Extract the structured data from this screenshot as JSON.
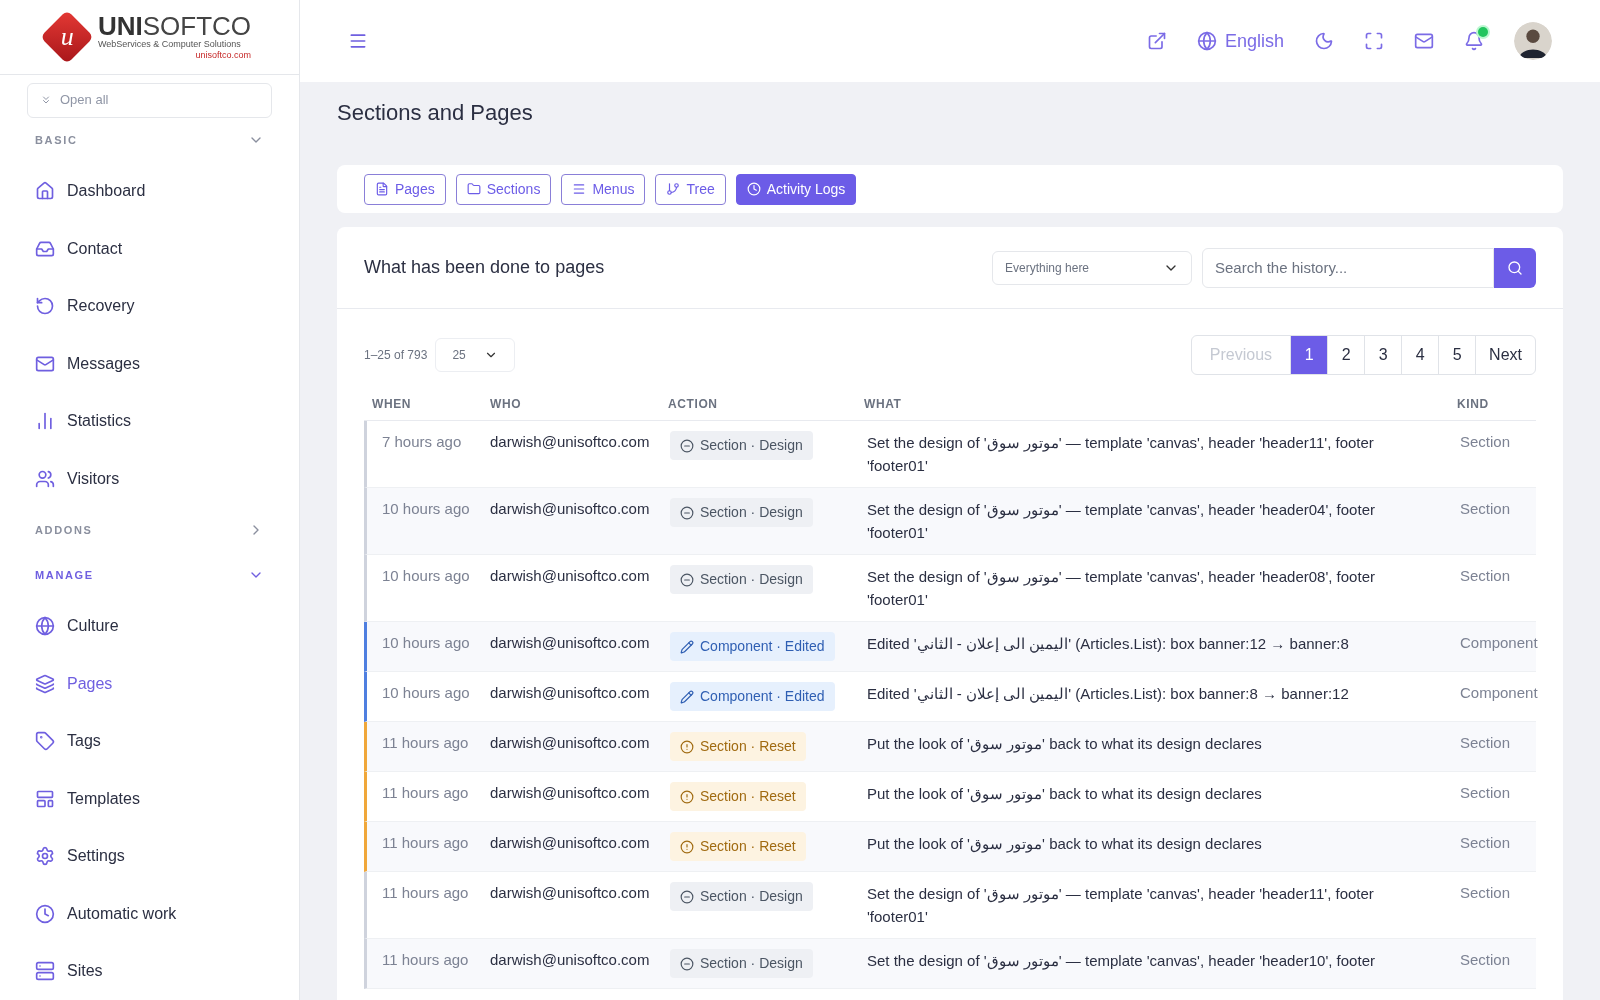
{
  "logo": {
    "mark": "u",
    "name_bold": "UNI",
    "name_light": "SOFTCO",
    "tagline": "WebServices & Computer Solutions",
    "url": "unisoftco.com"
  },
  "sidebar": {
    "open_all": "Open all",
    "groups": [
      {
        "title": "BASIC",
        "expanded": true,
        "items": [
          {
            "label": "Dashboard",
            "selected": false
          },
          {
            "label": "Contact",
            "selected": false
          },
          {
            "label": "Recovery",
            "selected": false
          },
          {
            "label": "Messages",
            "selected": false
          },
          {
            "label": "Statistics",
            "selected": false
          },
          {
            "label": "Visitors",
            "selected": false
          }
        ]
      },
      {
        "title": "ADDONS",
        "expanded": false
      },
      {
        "title": "MANAGE",
        "expanded": true,
        "items": [
          {
            "label": "Culture",
            "selected": false
          },
          {
            "label": "Pages",
            "selected": true
          },
          {
            "label": "Tags",
            "selected": false
          },
          {
            "label": "Templates",
            "selected": false
          },
          {
            "label": "Settings",
            "selected": false
          },
          {
            "label": "Automatic work",
            "selected": false
          },
          {
            "label": "Sites",
            "selected": false
          }
        ]
      }
    ]
  },
  "topbar": {
    "language": "English",
    "notification_dot": true
  },
  "page_title": "Sections and Pages",
  "tabs": [
    {
      "label": "Pages",
      "selected": false
    },
    {
      "label": "Sections",
      "selected": false
    },
    {
      "label": "Menus",
      "selected": false
    },
    {
      "label": "Tree",
      "selected": false
    },
    {
      "label": "Activity Logs",
      "selected": true
    }
  ],
  "log": {
    "title": "What has been done to pages",
    "filter": "Everything here",
    "search": {
      "placeholder": "Search the history..."
    },
    "range": "1–25 of 793",
    "page_size": "25",
    "pagination": {
      "previous": {
        "label": "Previous",
        "disabled": true
      },
      "pages": [
        {
          "label": "1",
          "selected": true
        },
        {
          "label": "2",
          "selected": false
        },
        {
          "label": "3",
          "selected": false
        },
        {
          "label": "4",
          "selected": false
        },
        {
          "label": "5",
          "selected": false
        }
      ],
      "next": {
        "label": "Next",
        "disabled": false
      }
    },
    "columns": [
      "WHEN",
      "WHO",
      "ACTION",
      "WHAT",
      "KIND"
    ],
    "rows": [
      {
        "when": "7 hours ago",
        "who": "darwish@unisoftco.com",
        "action": {
          "kind": "design",
          "label": "Section · Design"
        },
        "what": "Set the design of 'موتور سوق' — template 'canvas', header 'header11', footer 'footer01'",
        "type": "Section"
      },
      {
        "when": "10 hours ago",
        "who": "darwish@unisoftco.com",
        "action": {
          "kind": "design",
          "label": "Section · Design"
        },
        "what": "Set the design of 'موتور سوق' — template 'canvas', header 'header04', footer 'footer01'",
        "type": "Section"
      },
      {
        "when": "10 hours ago",
        "who": "darwish@unisoftco.com",
        "action": {
          "kind": "design",
          "label": "Section · Design"
        },
        "what": "Set the design of 'موتور سوق' — template 'canvas', header 'header08', footer 'footer01'",
        "type": "Section"
      },
      {
        "when": "10 hours ago",
        "who": "darwish@unisoftco.com",
        "action": {
          "kind": "edited",
          "label": "Component · Edited"
        },
        "what": "Edited 'اليمين الى إعلان - الثاني' (Articles.List): box banner:12 → banner:8",
        "type": "Component"
      },
      {
        "when": "10 hours ago",
        "who": "darwish@unisoftco.com",
        "action": {
          "kind": "edited",
          "label": "Component · Edited"
        },
        "what": "Edited 'اليمين الى إعلان - الثاني' (Articles.List): box banner:8 → banner:12",
        "type": "Component"
      },
      {
        "when": "11 hours ago",
        "who": "darwish@unisoftco.com",
        "action": {
          "kind": "reset",
          "label": "Section · Reset"
        },
        "what": "Put the look of 'موتور سوق' back to what its design declares",
        "type": "Section"
      },
      {
        "when": "11 hours ago",
        "who": "darwish@unisoftco.com",
        "action": {
          "kind": "reset",
          "label": "Section · Reset"
        },
        "what": "Put the look of 'موتور سوق' back to what its design declares",
        "type": "Section"
      },
      {
        "when": "11 hours ago",
        "who": "darwish@unisoftco.com",
        "action": {
          "kind": "reset",
          "label": "Section · Reset"
        },
        "what": "Put the look of 'موتور سوق' back to what its design declares",
        "type": "Section"
      },
      {
        "when": "11 hours ago",
        "who": "darwish@unisoftco.com",
        "action": {
          "kind": "design",
          "label": "Section · Design"
        },
        "what": "Set the design of 'موتور سوق' — template 'canvas', header 'header11', footer 'footer01'",
        "type": "Section"
      },
      {
        "when": "11 hours ago",
        "who": "darwish@unisoftco.com",
        "action": {
          "kind": "design",
          "label": "Section · Design"
        },
        "what": "Set the design of 'موتور سوق' — template 'canvas', header 'header10', footer",
        "type": "Section"
      }
    ]
  }
}
